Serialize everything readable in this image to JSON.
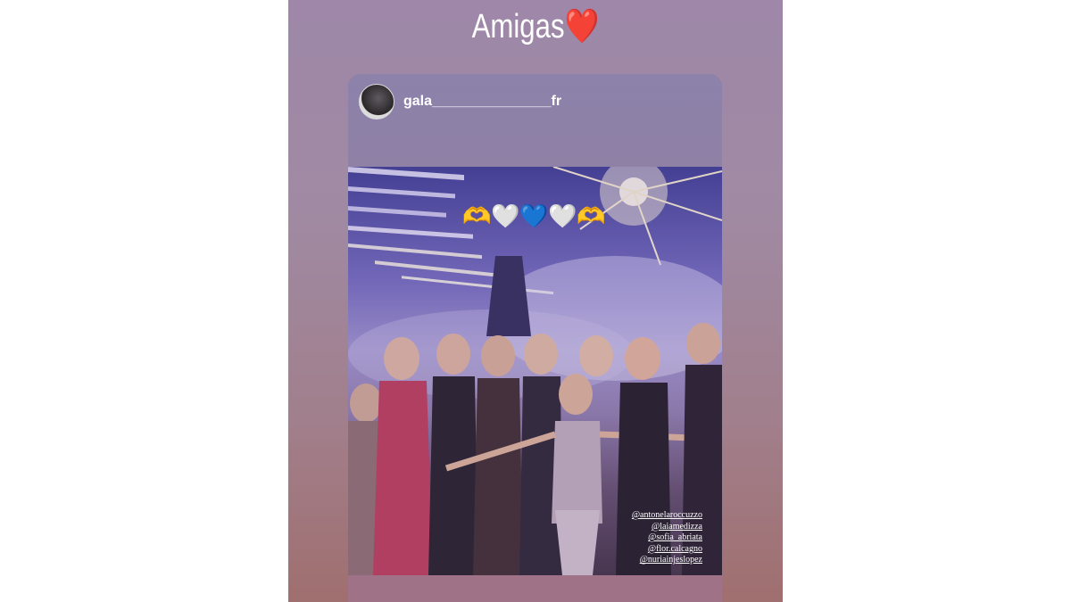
{
  "story": {
    "title": "Amigas",
    "title_emoji": "❤️",
    "background_top": "#9e87a8",
    "background_bottom": "#a06f6f"
  },
  "post": {
    "username": "gala_______________fr",
    "emoji_caption": [
      "🫶",
      "🤍",
      "💙",
      "🤍",
      "🫶"
    ],
    "tags": [
      "@antonelaroccuzzo",
      "@laiamedizza",
      "@sofia_abriata",
      "@flor.calcagno",
      "@nuriainjeslopez"
    ]
  }
}
